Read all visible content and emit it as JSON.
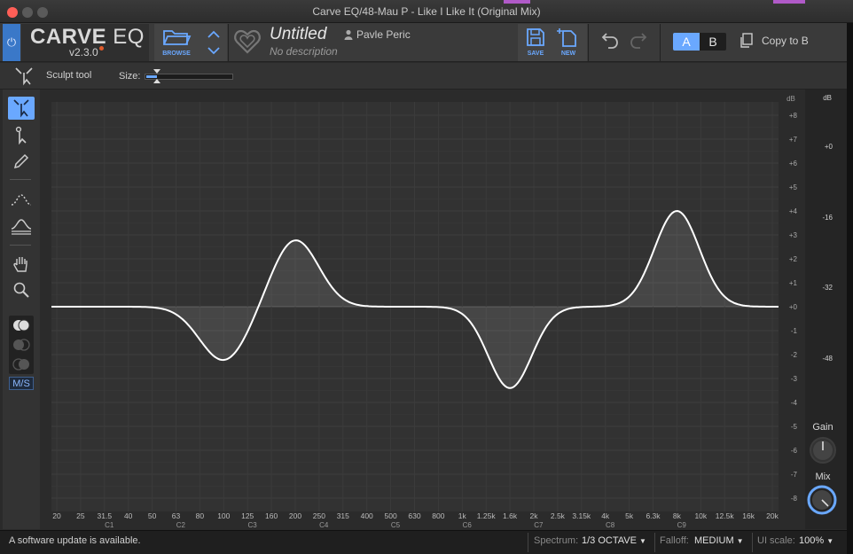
{
  "window": {
    "title": "Carve EQ/48-Mau P - Like I Like It (Original Mix)"
  },
  "header": {
    "brand_main": "CARVE",
    "brand_eq": "EQ",
    "version": "v2.3.0",
    "browse_label": "BROWSE",
    "preset_title": "Untitled",
    "preset_description": "No description",
    "author": "Pavle Peric",
    "save_label": "SAVE",
    "new_label": "NEW",
    "ab_a": "A",
    "ab_b": "B",
    "copy_label": "Copy to B"
  },
  "toolbar": {
    "tool_name": "Sculpt tool",
    "size_label": "Size:",
    "size_value": 0.1
  },
  "tools": [
    {
      "name": "sculpt-tool",
      "icon": "sculpt-icon",
      "active": true
    },
    {
      "name": "select-tool",
      "icon": "pointer-icon",
      "active": false
    },
    {
      "name": "pencil-tool",
      "icon": "pencil-icon",
      "active": false
    },
    {
      "name": "curve-tool",
      "icon": "dotted-curve-icon",
      "active": false
    },
    {
      "name": "multi-curve-tool",
      "icon": "stacked-curve-icon",
      "active": false
    },
    {
      "name": "hand-tool",
      "icon": "hand-icon",
      "active": false
    },
    {
      "name": "zoom-tool",
      "icon": "magnifier-icon",
      "active": false
    }
  ],
  "stereo_modes": {
    "ms_label": "M/S"
  },
  "eq_graph": {
    "db_axis_label": "dB",
    "db_ticks": [
      "+8",
      "+7",
      "+6",
      "+5",
      "+4",
      "+3",
      "+2",
      "+1",
      "+0",
      "-1",
      "-2",
      "-3",
      "-4",
      "-5",
      "-6",
      "-7",
      "-8"
    ],
    "freq_ticks": [
      "20",
      "25",
      "31.5",
      "40",
      "50",
      "63",
      "80",
      "100",
      "125",
      "160",
      "200",
      "250",
      "315",
      "400",
      "500",
      "630",
      "800",
      "1k",
      "1.25k",
      "1.6k",
      "2k",
      "2.5k",
      "3.15k",
      "4k",
      "5k",
      "6.3k",
      "8k",
      "10k",
      "12.5k",
      "16k",
      "20k"
    ],
    "note_ticks": [
      "C1",
      "C2",
      "C3",
      "C4",
      "C5",
      "C6",
      "C7",
      "C8",
      "C9"
    ],
    "curve_color": "#ffffff",
    "accent": "#6aa8ff"
  },
  "meter": {
    "db_label": "dB",
    "ticks": [
      "+0",
      "-16",
      "-32",
      "-48"
    ],
    "gain_label": "Gain",
    "mix_label": "Mix"
  },
  "status": {
    "message": "A software update is available.",
    "spectrum_label": "Spectrum:",
    "spectrum_value": "1/3 OCTAVE",
    "falloff_label": "Falloff:",
    "falloff_value": "MEDIUM",
    "uiscale_label": "UI scale:",
    "uiscale_value": "100%"
  }
}
